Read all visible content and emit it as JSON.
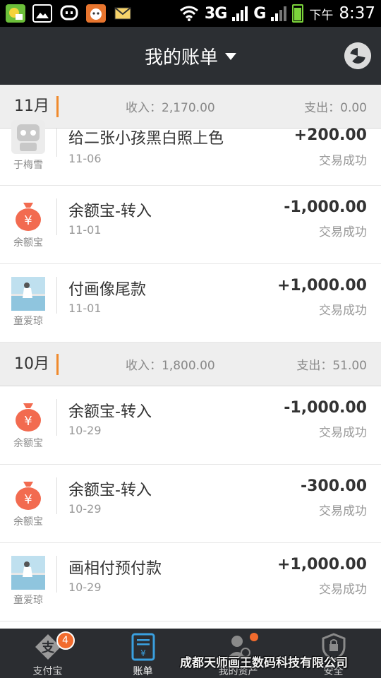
{
  "status_bar": {
    "network_label": "3G",
    "network2_label": "G",
    "time_prefix": "下午",
    "time": "8:37",
    "icons": [
      "app-notification-icon",
      "image-icon",
      "chat-icon",
      "app-icon",
      "mail-icon",
      "wifi-icon",
      "signal-icon",
      "battery-icon"
    ]
  },
  "header": {
    "title": "我的账单",
    "accent": "#2c2f33"
  },
  "months": [
    {
      "name": "11月",
      "income": "收入：2,170.00",
      "expense": "支出：0.00",
      "rows": [
        {
          "title": "给二张小孩黑白照上色",
          "date": "11-06",
          "amount": "+200.00",
          "status": "交易成功",
          "source": "于梅雪",
          "icon": "robot-avatar"
        },
        {
          "title": "余额宝-转入",
          "date": "11-01",
          "amount": "-1,000.00",
          "status": "交易成功",
          "source": "余额宝",
          "icon": "money-bag-icon"
        },
        {
          "title": "付画像尾款",
          "date": "11-01",
          "amount": "+1,000.00",
          "status": "交易成功",
          "source": "童爱琼",
          "icon": "photo-avatar"
        }
      ]
    },
    {
      "name": "10月",
      "income": "收入：1,800.00",
      "expense": "支出：51.00",
      "rows": [
        {
          "title": "余额宝-转入",
          "date": "10-29",
          "amount": "-1,000.00",
          "status": "交易成功",
          "source": "余额宝",
          "icon": "money-bag-icon"
        },
        {
          "title": "余额宝-转入",
          "date": "10-29",
          "amount": "-300.00",
          "status": "交易成功",
          "source": "余额宝",
          "icon": "money-bag-icon"
        },
        {
          "title": "画相付预付款",
          "date": "10-29",
          "amount": "+1,000.00",
          "status": "交易成功",
          "source": "童爱琼",
          "icon": "photo-avatar"
        }
      ]
    }
  ],
  "tabbar": {
    "tabs": [
      {
        "label": "支付宝",
        "badge": "4",
        "icon": "alipay-icon"
      },
      {
        "label": "账单",
        "icon": "bill-icon",
        "active": true
      },
      {
        "label": "我的资产",
        "icon": "assets-icon",
        "dot": true
      },
      {
        "label": "安全",
        "icon": "shield-icon"
      }
    ]
  },
  "watermark": "成都天师画王数码科技有限公司",
  "colors": {
    "accent_orange": "#f08a2c",
    "header_bg": "#2c2f33",
    "money_bag": "#f26b50",
    "active_tab": "#3aa0e0"
  }
}
